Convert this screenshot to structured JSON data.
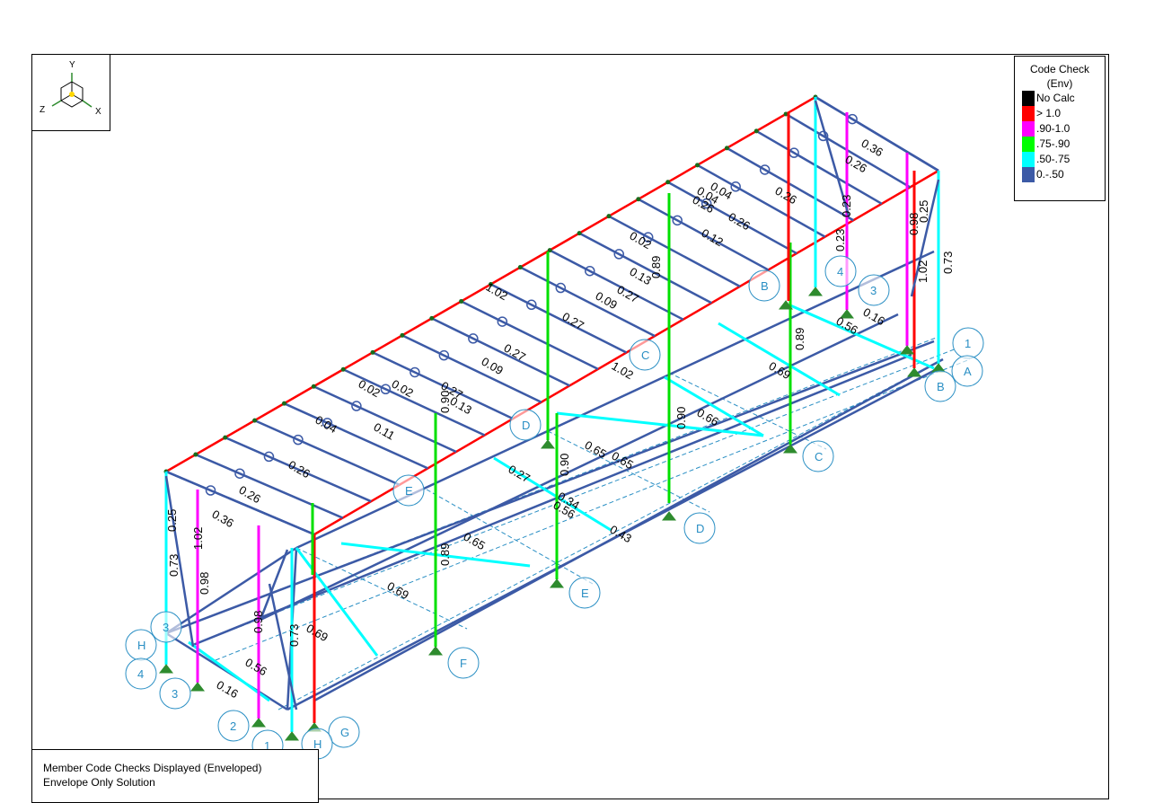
{
  "legend": {
    "title_line1": "Code Check",
    "title_line2": "(Env)",
    "items": [
      {
        "label": "No Calc",
        "color": "#000000"
      },
      {
        "label": "> 1.0",
        "color": "#ff0000"
      },
      {
        "label": ".90-1.0",
        "color": "#ff00ff"
      },
      {
        "label": ".75-.90",
        "color": "#00ff00"
      },
      {
        "label": ".50-.75",
        "color": "#00ffff"
      },
      {
        "label": "0.-.50",
        "color": "#3c5aa6"
      }
    ]
  },
  "axis_triad": {
    "y": "Y",
    "x": "X",
    "z": "Z"
  },
  "status": {
    "line1": "Member Code Checks Displayed (Enveloped)",
    "line2": "Envelope Only Solution"
  },
  "colors": {
    "member_low": "#3c5aa6",
    "member_mid": "#00ffff",
    "member_green": "#00e000",
    "member_magenta": "#ff00ff",
    "member_red": "#ff0000",
    "grid_line": "#2a8fc4",
    "support": "#2e8b2e",
    "node": "#1a6a1a"
  },
  "grid_bubbles": [
    {
      "label": "1"
    },
    {
      "label": "A"
    },
    {
      "label": "B"
    },
    {
      "label": "C"
    },
    {
      "label": "D"
    },
    {
      "label": "E"
    },
    {
      "label": "F"
    },
    {
      "label": "G"
    },
    {
      "label": "H"
    },
    {
      "label": "H"
    },
    {
      "label": "4"
    },
    {
      "label": "3"
    },
    {
      "label": "2"
    },
    {
      "label": "1"
    },
    {
      "label": "B"
    },
    {
      "label": "4"
    },
    {
      "label": "3"
    },
    {
      "label": "C"
    },
    {
      "label": "D"
    },
    {
      "label": "E"
    },
    {
      "label": "3"
    }
  ],
  "member_values": [
    "0.36",
    "0.26",
    "0.25",
    "0.73",
    "1.02",
    "0.98",
    "0.89",
    "0.89",
    "0.90",
    "0.90",
    "0.89",
    "0.69",
    "0.65",
    "0.65",
    "0.69",
    "0.56",
    "0.16",
    "0.16",
    "0.56",
    "0.66",
    "0.69",
    "0.26",
    "0.26",
    "0.26",
    "0.26",
    "0.36",
    "0.25",
    "0.73",
    "1.02",
    "0.98",
    "0.13",
    "0.27",
    "0.09",
    "0.27",
    "0.27",
    "0.09",
    "0.27",
    "0.13",
    "1.02",
    "1.02",
    "0.04",
    "0.02",
    "0.04",
    "0.11",
    "0.12",
    "0.02",
    "0.02",
    "0.04",
    "0.26",
    "0.23",
    "0.65",
    "0.27",
    "0.34",
    "0.43",
    "0.90",
    "0.73",
    "0.56",
    "0.98",
    "0.23"
  ]
}
